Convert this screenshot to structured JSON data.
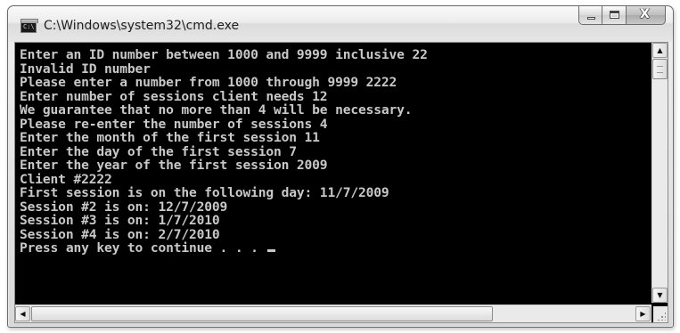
{
  "window": {
    "title": "C:\\Windows\\system32\\cmd.exe",
    "icon": "cmd-icon",
    "icon_text": "C:\\",
    "controls": {
      "minimize": "minimize-icon",
      "maximize": "maximize-icon",
      "close": "close-icon",
      "close_glyph": "X"
    }
  },
  "console": {
    "lines": [
      "Enter an ID number between 1000 and 9999 inclusive 22",
      "Invalid ID number",
      "Please enter a number from 1000 through 9999 2222",
      "Enter number of sessions client needs 12",
      "We guarantee that no more than 4 will be necessary.",
      "Please re-enter the number of sessions 4",
      "Enter the month of the first session 11",
      "Enter the day of the first session 7",
      "Enter the year of the first session 2009",
      "Client #2222",
      "First session is on the following day: 11/7/2009",
      "Session #2 is on: 12/7/2009",
      "Session #3 is on: 1/7/2010",
      "Session #4 is on: 2/7/2010",
      "Press any key to continue . . . "
    ],
    "text_color": "#c8c8c8",
    "background": "#000000"
  },
  "scrollbars": {
    "up_arrow": "▲",
    "down_arrow": "▼",
    "left_arrow": "◀",
    "right_arrow": "▶"
  }
}
